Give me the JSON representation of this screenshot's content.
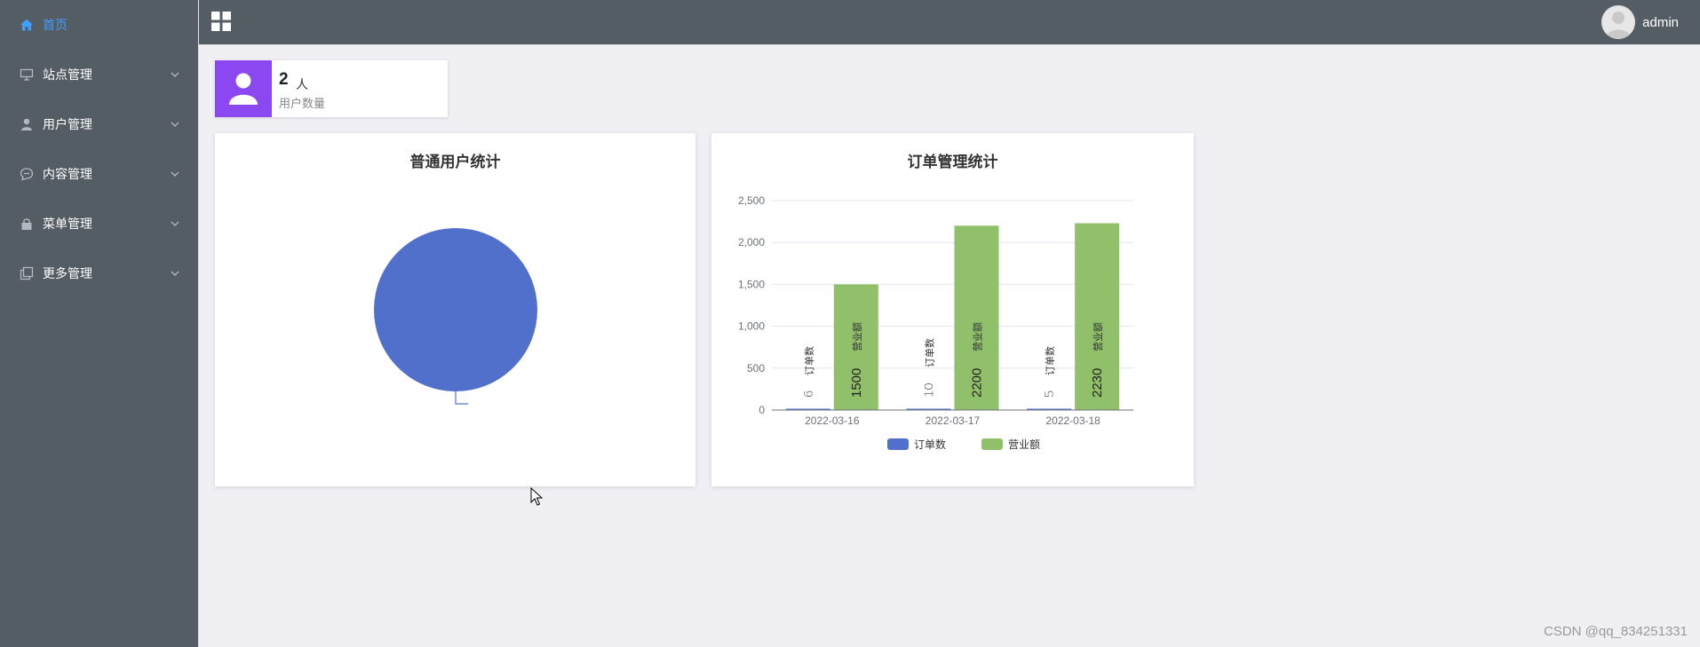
{
  "sidebar": {
    "items": [
      {
        "label": "首页",
        "icon": "home-icon",
        "active": true
      },
      {
        "label": "站点管理",
        "icon": "monitor-icon",
        "active": false
      },
      {
        "label": "用户管理",
        "icon": "user-icon",
        "active": false
      },
      {
        "label": "内容管理",
        "icon": "comment-icon",
        "active": false
      },
      {
        "label": "菜单管理",
        "icon": "lock-icon",
        "active": false
      },
      {
        "label": "更多管理",
        "icon": "copy-icon",
        "active": false
      }
    ]
  },
  "header": {
    "username": "admin"
  },
  "stat_card": {
    "value": "2",
    "unit": "人",
    "label": "用户数量"
  },
  "pie_panel": {
    "title": "普通用户统计"
  },
  "bar_panel": {
    "title": "订单管理统计"
  },
  "watermark": "CSDN @qq_834251331",
  "colors": {
    "sidebar_bg": "#545c64",
    "active": "#409eff",
    "stat_icon_bg": "#8b48f0",
    "series_blue": "#5070cc",
    "series_green": "#91c06b"
  },
  "chart_data": [
    {
      "type": "pie",
      "title": "普通用户统计",
      "slices": [
        {
          "value": 1
        }
      ]
    },
    {
      "type": "bar",
      "title": "订单管理统计",
      "categories": [
        "2022-03-16",
        "2022-03-17",
        "2022-03-18"
      ],
      "series": [
        {
          "name": "订单数",
          "values": [
            6,
            10,
            5
          ]
        },
        {
          "name": "营业额",
          "values": [
            1500,
            2200,
            2230
          ]
        }
      ],
      "ylim": [
        0,
        2500
      ],
      "yticks": [
        "0",
        "500",
        "1,000",
        "1,500",
        "2,000",
        "2,500"
      ],
      "legend": "bottom"
    }
  ]
}
